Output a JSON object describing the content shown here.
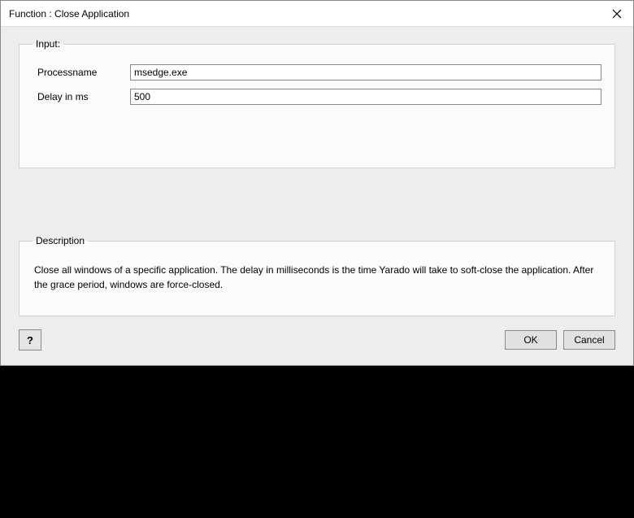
{
  "window": {
    "title": "Function : Close Application"
  },
  "input_section": {
    "legend": "Input:",
    "fields": {
      "processname": {
        "label": "Processname",
        "value": "msedge.exe"
      },
      "delay": {
        "label": "Delay in ms",
        "value": "500"
      }
    }
  },
  "description_section": {
    "legend": "Description",
    "text": "Close all windows of a specific application. The delay in milliseconds is the time Yarado will take to soft-close the application. After the grace period, windows are force-closed."
  },
  "buttons": {
    "help": "?",
    "ok": "OK",
    "cancel": "Cancel"
  }
}
